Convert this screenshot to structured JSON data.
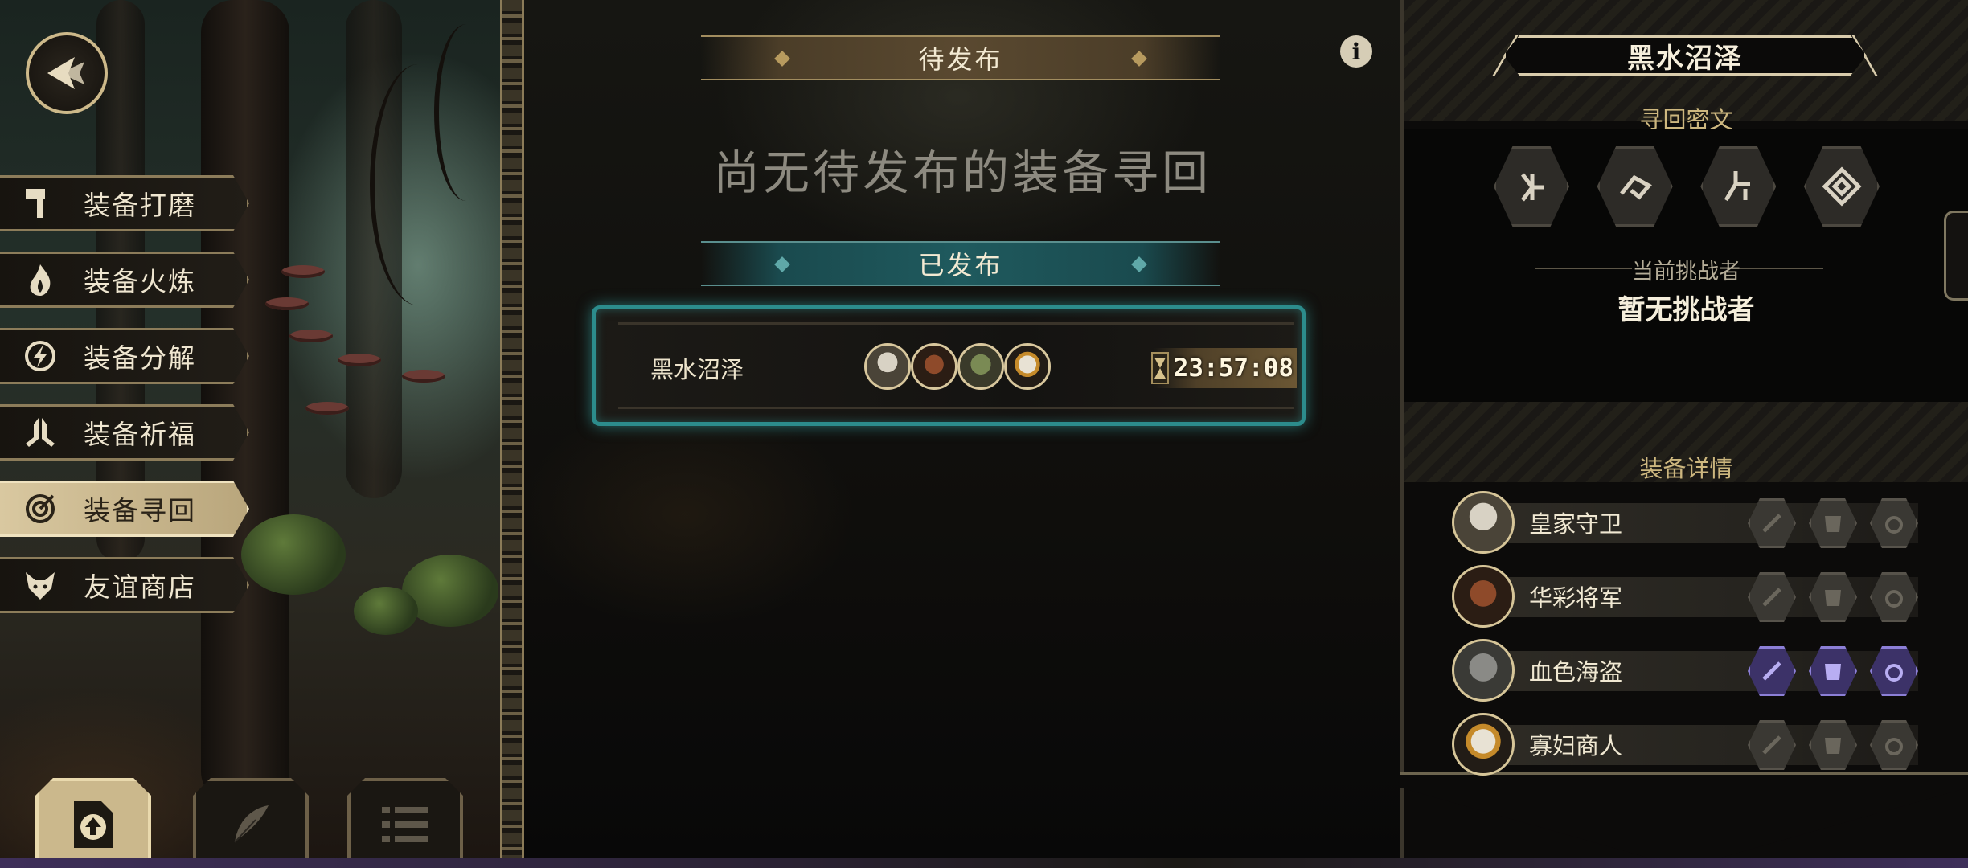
{
  "left_menu": {
    "items": [
      {
        "label": "装备打磨",
        "icon": "hammer-icon",
        "active": false
      },
      {
        "label": "装备火炼",
        "icon": "flame-icon",
        "active": false
      },
      {
        "label": "装备分解",
        "icon": "disassemble-icon",
        "active": false
      },
      {
        "label": "装备祈福",
        "icon": "prayer-hands-icon",
        "active": false
      },
      {
        "label": "装备寻回",
        "icon": "target-icon",
        "active": true
      },
      {
        "label": "友谊商店",
        "icon": "fox-icon",
        "active": false
      }
    ]
  },
  "bottom_tabs": [
    {
      "icon": "publish-upload-icon",
      "active": true
    },
    {
      "icon": "feather-icon",
      "active": false
    },
    {
      "icon": "list-icon",
      "active": false
    }
  ],
  "center": {
    "pending_header": "待发布",
    "empty_message": "尚无待发布的装备寻回",
    "published_header": "已发布",
    "quest": {
      "name": "黑水沼泽",
      "timer": "23:57:08",
      "timer_icon": "hourglass-icon"
    }
  },
  "right_panel": {
    "title": "黑水沼泽",
    "cipher_header": "寻回密文",
    "runes": [
      "rune-1-icon",
      "rune-2-icon",
      "rune-3-icon",
      "rune-4-icon"
    ],
    "challenger_label": "当前挑战者",
    "challenger_value": "暂无挑战者",
    "equipment_header": "装备详情",
    "characters": [
      {
        "name": "皇家守卫",
        "weapon": false,
        "armor": false,
        "trinket": false
      },
      {
        "name": "华彩将军",
        "weapon": false,
        "armor": false,
        "trinket": false
      },
      {
        "name": "血色海盗",
        "weapon": true,
        "armor": true,
        "trinket": true
      },
      {
        "name": "寡妇商人",
        "weapon": false,
        "armor": false,
        "trinket": false
      }
    ]
  },
  "colors": {
    "accent_gold": "#cdb77f",
    "published_teal": "#2c8c8c",
    "filled_slot_purple": "#8c7fd6"
  }
}
